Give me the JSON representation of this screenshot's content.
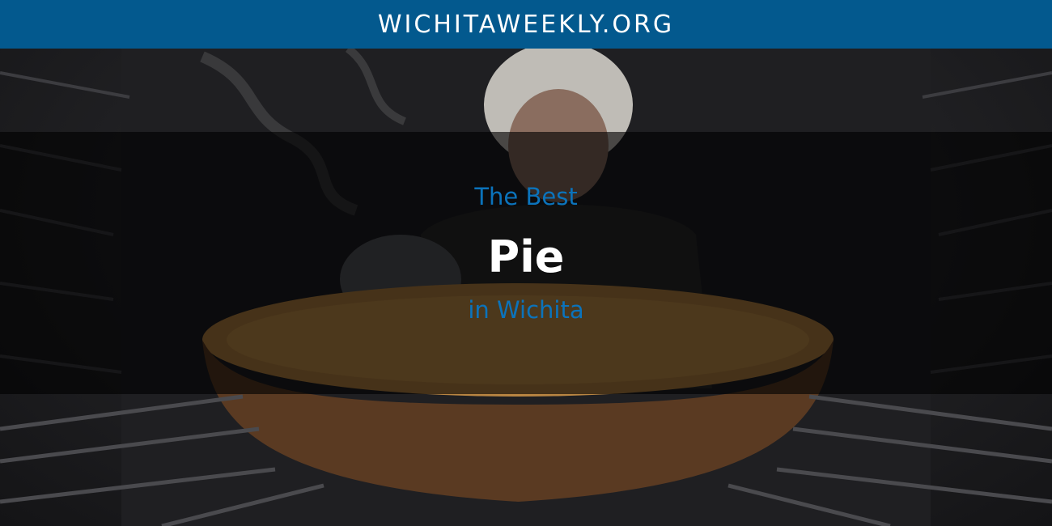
{
  "header": {
    "site_name": "WICHITAWEEKLY.ORG",
    "background_color": "#03598e"
  },
  "hero": {
    "kicker": "The Best",
    "title": "Pie",
    "location": "in Wichita",
    "accent_color": "#0b73bb",
    "image_subject": "woman-pulling-pie-from-oven"
  }
}
